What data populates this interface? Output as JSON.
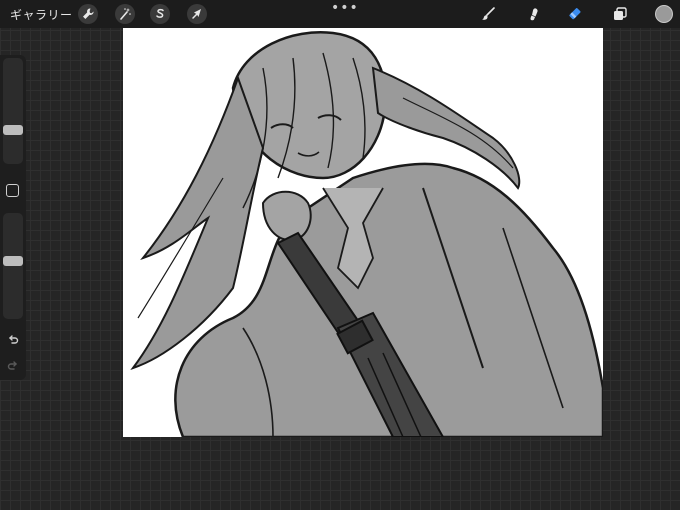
{
  "topbar": {
    "gallery_label": "ギャラリー",
    "left_tools": [
      {
        "name": "actions-wrench",
        "icon": "wrench-icon"
      },
      {
        "name": "adjustments-wand",
        "icon": "magic-wand-icon"
      },
      {
        "name": "selection",
        "icon": "selection-s-icon"
      },
      {
        "name": "transform",
        "icon": "arrow-cursor-icon"
      }
    ],
    "more_label": "•••",
    "right_tools": [
      {
        "name": "brush",
        "icon": "brush-icon",
        "active": false
      },
      {
        "name": "smudge",
        "icon": "smudge-icon",
        "active": false
      },
      {
        "name": "eraser",
        "icon": "eraser-icon",
        "active": true
      },
      {
        "name": "layers",
        "icon": "layers-icon",
        "active": false
      }
    ],
    "current_color": "#9a9a9a",
    "active_tool_color": "#3b8cf0"
  },
  "sidebar": {
    "brush_size": 0.3,
    "opacity": 0.55,
    "modify_icon": "square-icon",
    "undo_icon": "undo-icon",
    "redo_icon": "redo-icon"
  },
  "canvas": {
    "artwork": "sketch-illustration",
    "background": "#ffffff",
    "fill": "#9b9b9b",
    "stroke": "#1a1a1a"
  }
}
